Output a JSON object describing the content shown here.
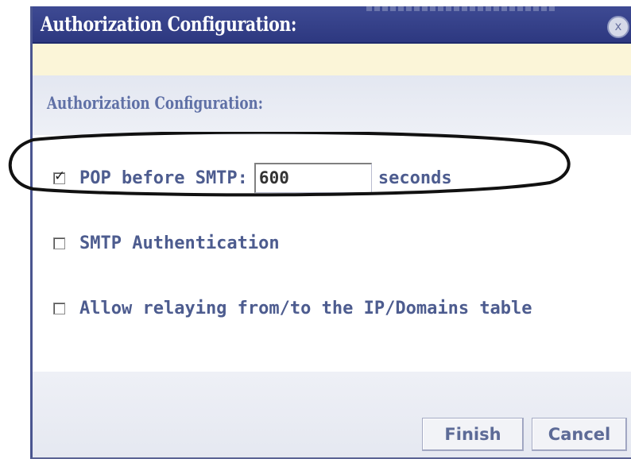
{
  "window": {
    "title": "Authorization Configuration:",
    "close_glyph": "x"
  },
  "section": {
    "title": "Authorization Configuration:"
  },
  "options": {
    "pop_before_smtp": {
      "checked": true,
      "label": "POP before SMTP:",
      "value": "600",
      "unit": "seconds"
    },
    "smtp_auth": {
      "checked": false,
      "label": "SMTP Authentication"
    },
    "allow_relaying": {
      "checked": false,
      "label": "Allow relaying from/to the IP/Domains table"
    }
  },
  "buttons": {
    "finish": "Finish",
    "cancel": "Cancel"
  },
  "colors": {
    "titlebar": "#2d3880",
    "accent_text": "#5f70a6",
    "highlight_band": "#fbf5d8"
  }
}
